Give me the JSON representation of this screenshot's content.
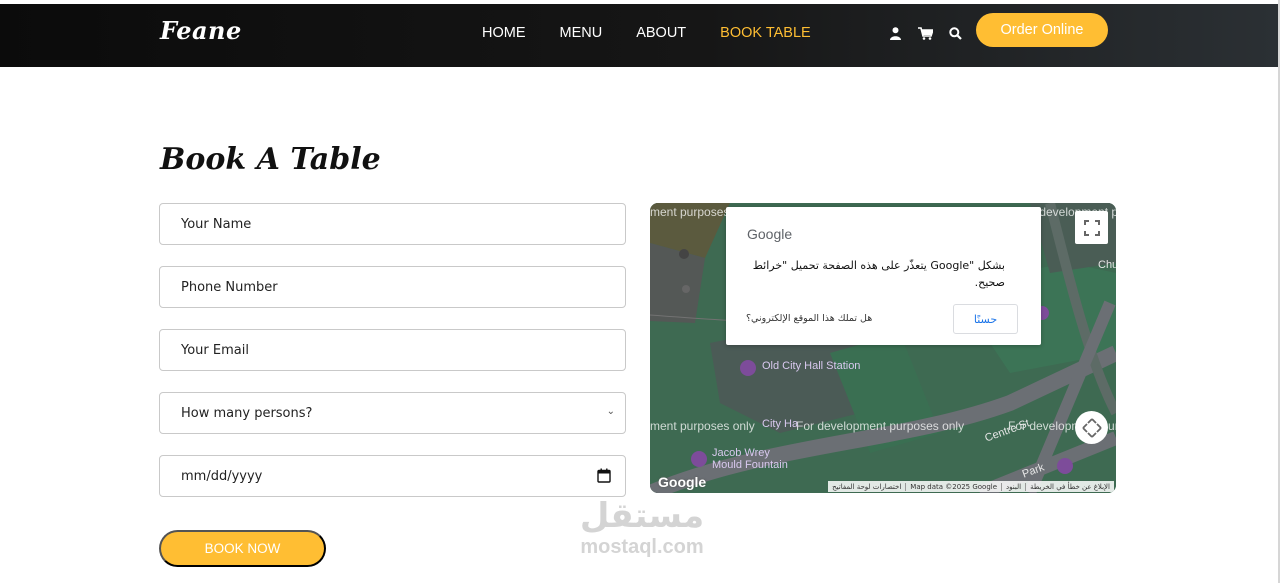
{
  "header": {
    "brand": "Feane",
    "nav": [
      "HOME",
      "MENU",
      "ABOUT",
      "BOOK TABLE"
    ],
    "active_nav": "BOOK TABLE",
    "icons": [
      "user-icon",
      "cart-icon",
      "search-icon"
    ],
    "order_label": "Order Online"
  },
  "form": {
    "title": "Book A Table",
    "name_placeholder": "Your Name",
    "phone_placeholder": "Phone Number",
    "email_placeholder": "Your Email",
    "persons_selected": "How many persons?",
    "date_placeholder": "mm/dd/yyyy",
    "submit_label": "BOOK NOW"
  },
  "map": {
    "dialog_logo": "Google",
    "dialog_message": "بشكل \"Google يتعذّر على هذه الصفحة تحميل \"خرائط صحيح.",
    "dialog_own_site": "هل تملك هذا الموقع الإلكتروني؟",
    "dialog_ok": "حسنًا",
    "watermark_text": "For development purposes only",
    "watermark_left_fragment": "ment purposes only",
    "watermark_top_fragment": "r development purposes",
    "labels": {
      "old_city_hall": "Old City Hall Station",
      "city_hall": "City Ha",
      "fountain_line1": "Jacob Wrey",
      "fountain_line2": "Mould Fountain",
      "centre_st": "Centre St",
      "park": "Park",
      "chu": "Chu"
    },
    "google_mark": "Google",
    "attribution": [
      "الإبلاغ عن خطأ في الخريطة",
      "البنود",
      "Map data ©2025 Google",
      "اختصارات لوحة المفاتيح"
    ]
  },
  "watermark": {
    "arabic": "مستقل",
    "latin": "mostaql.com"
  },
  "colors": {
    "accent": "#ffbe33",
    "header_bg": "#0b0b0b",
    "map_green": "#3f6e55"
  }
}
